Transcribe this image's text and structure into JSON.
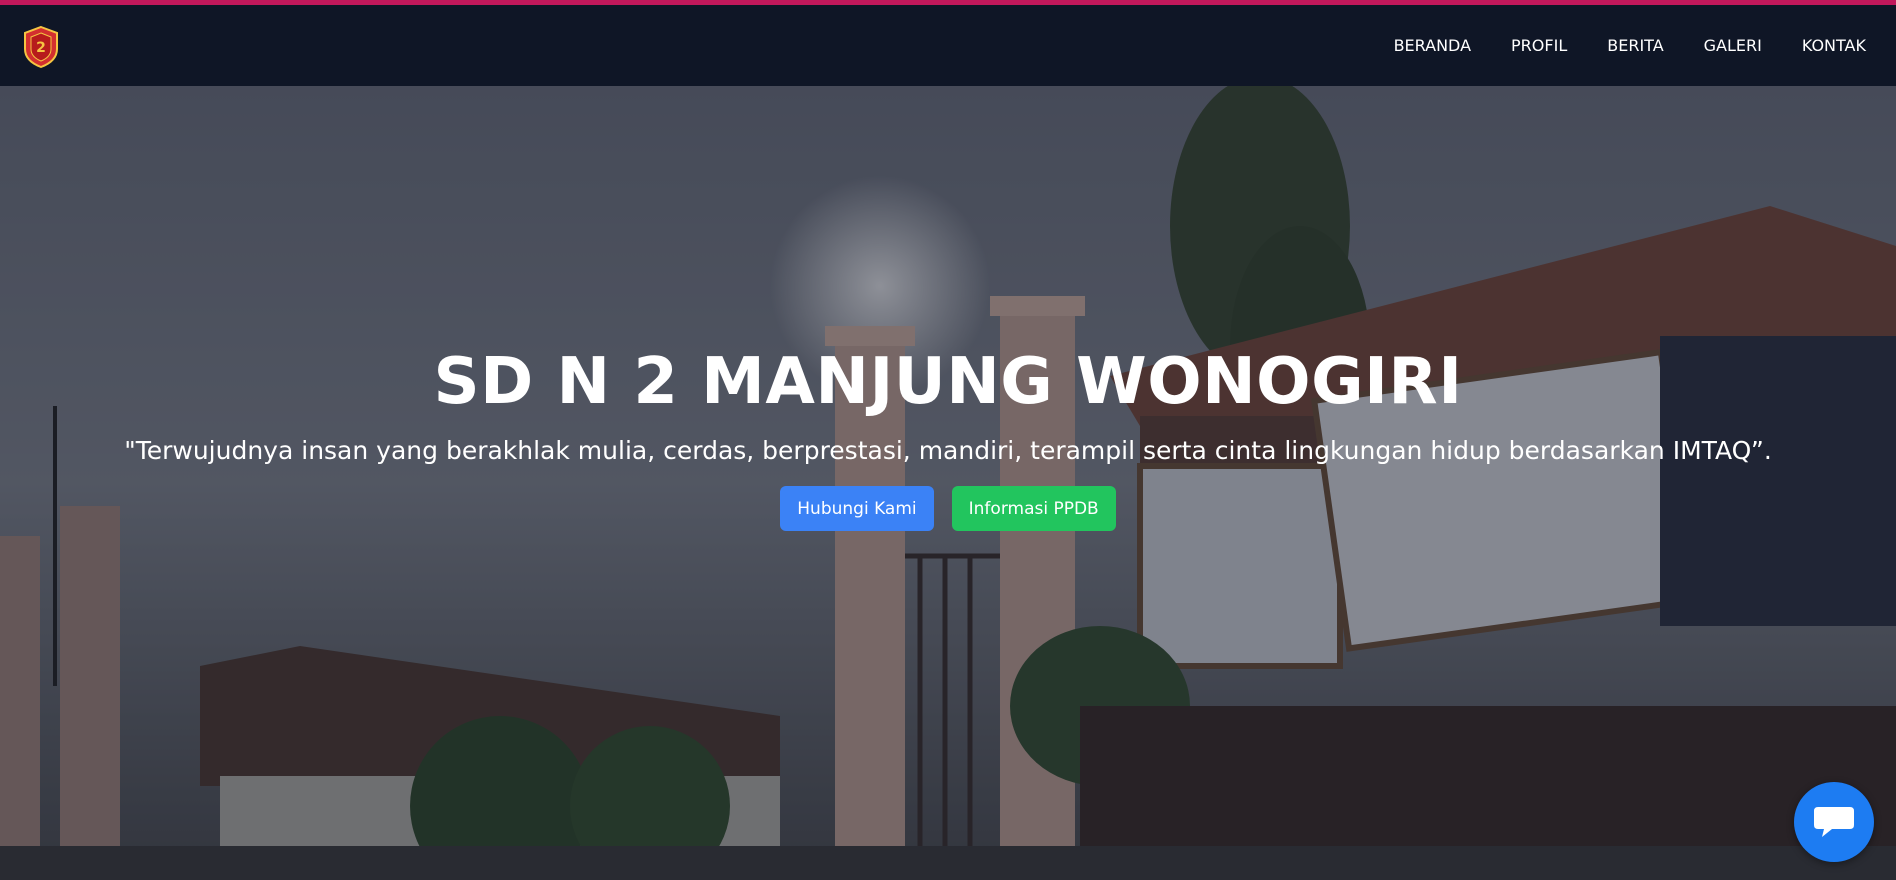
{
  "header": {
    "logo": "school-crest-logo",
    "logo_number": "2",
    "nav": [
      {
        "label": "BERANDA"
      },
      {
        "label": "PROFIL"
      },
      {
        "label": "BERITA"
      },
      {
        "label": "GALERI"
      },
      {
        "label": "KONTAK"
      }
    ]
  },
  "hero": {
    "title": "SD N 2 MANJUNG WONOGIRI",
    "quote": "\"Terwujudnya insan yang berakhlak mulia, cerdas, berprestasi, mandiri, terampil serta cinta lingkungan hidup berdasarkan IMTAQ”.",
    "buttons": {
      "contact": "Hubungi Kami",
      "ppdb": "Informasi PPDB"
    }
  },
  "chat": {
    "icon": "chat-bubble-icon"
  },
  "colors": {
    "accent_line": "#c2185b",
    "navbar": "#0f1626",
    "btn_blue": "#3b82f6",
    "btn_green": "#22c55e",
    "chat": "#1d7cf2"
  }
}
